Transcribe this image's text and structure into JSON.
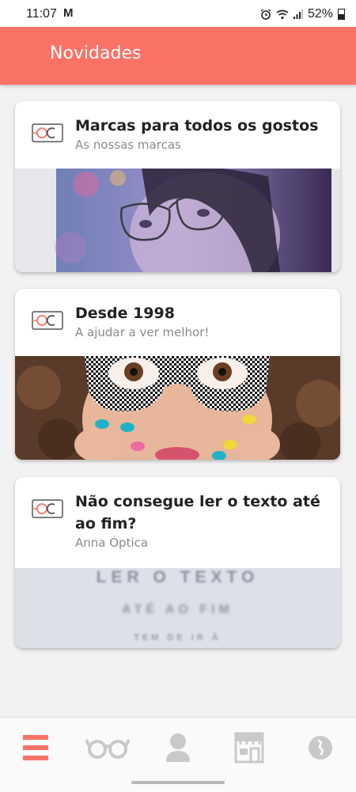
{
  "status_bar": {
    "time": "11:07",
    "mail_icon": "M",
    "battery": "52%",
    "icons": [
      "alarm-icon",
      "wifi-icon",
      "signal-icon",
      "battery-icon"
    ]
  },
  "app_bar": {
    "title": "Novidades"
  },
  "cards": [
    {
      "title": "Marcas para todos os gostos",
      "subtitle": "As nossas marcas",
      "image": "woman-with-glasses-image"
    },
    {
      "title": "Desde 1998",
      "subtitle": "A ajudar a ver melhor!",
      "image": "checkered-glasses-image"
    },
    {
      "title": "Não consegue ler o texto até ao fim?",
      "subtitle": "Anna Óptica",
      "image": "blurred-text-image",
      "image_lines": [
        "LER O TEXTO",
        "ATÉ AO FIM",
        "TEM DE IR À"
      ]
    }
  ],
  "bottom_nav": {
    "items": [
      "menu-icon",
      "glasses-icon",
      "profile-icon",
      "store-icon",
      "info-icon"
    ]
  },
  "colors": {
    "accent": "#fb7266",
    "icon_inactive": "#c9c9c9"
  }
}
